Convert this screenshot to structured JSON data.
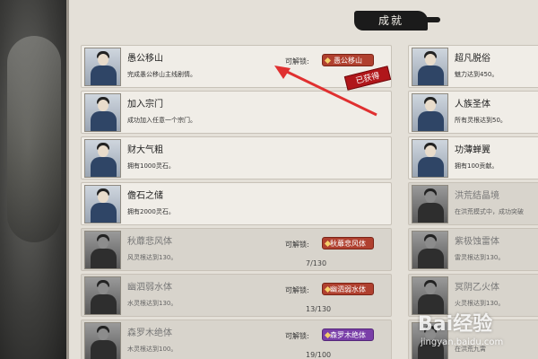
{
  "panel": {
    "title": "成就"
  },
  "unlock_label": "可解锁:",
  "obtained_stamp": "已获得",
  "left_column": [
    {
      "name": "愚公移山",
      "desc": "完成愚公移山主线剧情。",
      "locked": false,
      "unlock_item": "愚公移山",
      "unlock_color": "red",
      "progress": "",
      "obtained": true
    },
    {
      "name": "加入宗门",
      "desc": "成功加入任意一个宗门。",
      "locked": false,
      "unlock_item": "",
      "progress": "",
      "obtained": false
    },
    {
      "name": "财大气粗",
      "desc": "拥有1000灵石。",
      "locked": false,
      "unlock_item": "",
      "progress": "",
      "obtained": false
    },
    {
      "name": "儋石之储",
      "desc": "拥有2000灵石。",
      "locked": false,
      "unlock_item": "",
      "progress": "",
      "obtained": false
    },
    {
      "name": "秋蘼悲风体",
      "desc": "风灵根达到130。",
      "locked": true,
      "unlock_item": "秋蘼悲风体",
      "unlock_color": "red",
      "progress": "7/130",
      "obtained": false
    },
    {
      "name": "幽泗弱水体",
      "desc": "水灵根达到130。",
      "locked": true,
      "unlock_item": "幽泗弱水体",
      "unlock_color": "red",
      "progress": "13/130",
      "obtained": false
    },
    {
      "name": "森罗木绝体",
      "desc": "木灵根达到100。",
      "locked": true,
      "unlock_item": "森罗木绝体",
      "unlock_color": "purple",
      "progress": "19/100",
      "obtained": false
    }
  ],
  "right_column": [
    {
      "name": "超凡脱俗",
      "desc": "魅力达到450。",
      "locked": false
    },
    {
      "name": "人族圣体",
      "desc": "所有灵根达到50。",
      "locked": false
    },
    {
      "name": "功薄蝉翼",
      "desc": "拥有100贡献。",
      "locked": false
    },
    {
      "name": "洪荒结晶境",
      "desc": "在洪荒模式中，成功突破",
      "locked": true
    },
    {
      "name": "紫极蚀雷体",
      "desc": "雷灵根达到130。",
      "locked": true
    },
    {
      "name": "冥阴乙火体",
      "desc": "火灵根达到130。",
      "locked": true
    },
    {
      "name": "",
      "desc": "在洪荒九霄",
      "locked": true
    }
  ],
  "watermark": {
    "brand": "Bai经验",
    "url": "jingyan.baidu.com"
  },
  "colors": {
    "tag_red": "#b0402f",
    "tag_purple": "#7a3fa8",
    "stamp_red": "#b0161a",
    "arrow_red": "#e03030"
  }
}
